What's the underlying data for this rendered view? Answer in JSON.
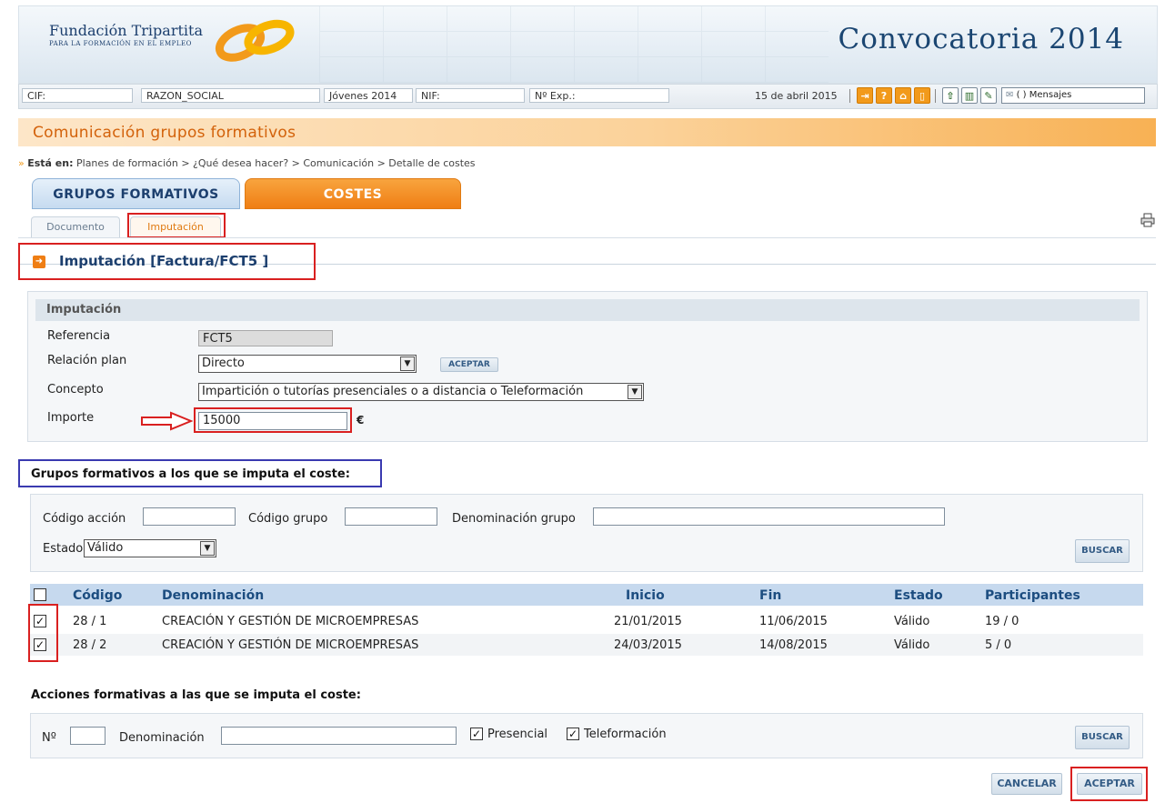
{
  "header": {
    "org_name": "Fundación Tripartita",
    "org_sub": "PARA LA FORMACIÓN EN EL EMPLEO",
    "title": "Convocatoria 2014"
  },
  "infobar": {
    "cif": "CIF:",
    "razon_social": "RAZON_SOCIAL",
    "program": "Jóvenes 2014",
    "nif": "NIF:",
    "exp": "Nº Exp.:",
    "date": "15 de abril 2015",
    "messages": "( ) Mensajes"
  },
  "section_title": "Comunicación grupos formativos",
  "breadcrumb": {
    "prefix": "Está en:",
    "path": "Planes de formación > ¿Qué desea hacer? > Comunicación > Detalle de costes"
  },
  "main_tabs": {
    "grupos": "GRUPOS FORMATIVOS",
    "costes": "COSTES"
  },
  "sub_tabs": {
    "documento": "Documento",
    "imputacion": "Imputación"
  },
  "imputacion_title": "Imputación [Factura/FCT5 ]",
  "form": {
    "heading": "Imputación",
    "referencia_label": "Referencia",
    "referencia_value": "FCT5",
    "relacion_label": "Relación plan",
    "relacion_value": "Directo",
    "aceptar_small": "ACEPTAR",
    "concepto_label": "Concepto",
    "concepto_value": "Impartición o tutorías presenciales o a distancia o Teleformación",
    "importe_label": "Importe",
    "importe_value": "15000",
    "currency": "€"
  },
  "grupos": {
    "title": "Grupos formativos a los que se imputa el coste:",
    "codigo_accion_label": "Código acción",
    "codigo_grupo_label": "Código grupo",
    "denominacion_grupo_label": "Denominación grupo",
    "estado_label": "Estado",
    "estado_value": "Válido",
    "buscar": "BUSCAR",
    "columns": [
      "Código",
      "Denominación",
      "Inicio",
      "Fin",
      "Estado",
      "Participantes"
    ],
    "rows": [
      {
        "checked": "✓",
        "codigo": "28 / 1",
        "denominacion": "CREACIÓN Y GESTIÓN DE MICROEMPRESAS",
        "inicio": "21/01/2015",
        "fin": "11/06/2015",
        "estado": "Válido",
        "participantes": "19 / 0"
      },
      {
        "checked": "✓",
        "codigo": "28 / 2",
        "denominacion": "CREACIÓN Y GESTIÓN DE MICROEMPRESAS",
        "inicio": "24/03/2015",
        "fin": "14/08/2015",
        "estado": "Válido",
        "participantes": "5 / 0"
      }
    ]
  },
  "acciones": {
    "title": "Acciones formativas a las que se imputa el coste:",
    "num_label": "Nº",
    "denominacion_label": "Denominación",
    "presencial_label": "Presencial",
    "presencial_check": "✓",
    "teleformacion_label": "Teleformación",
    "teleformacion_check": "✓",
    "buscar": "BUSCAR"
  },
  "footer": {
    "cancelar": "CANCELAR",
    "aceptar": "ACEPTAR"
  },
  "colors": {
    "accent_orange": "#ef7e14",
    "brand_blue": "#1c3f6e",
    "highlight_red": "#d92020",
    "highlight_blue": "#3a3ab0"
  }
}
